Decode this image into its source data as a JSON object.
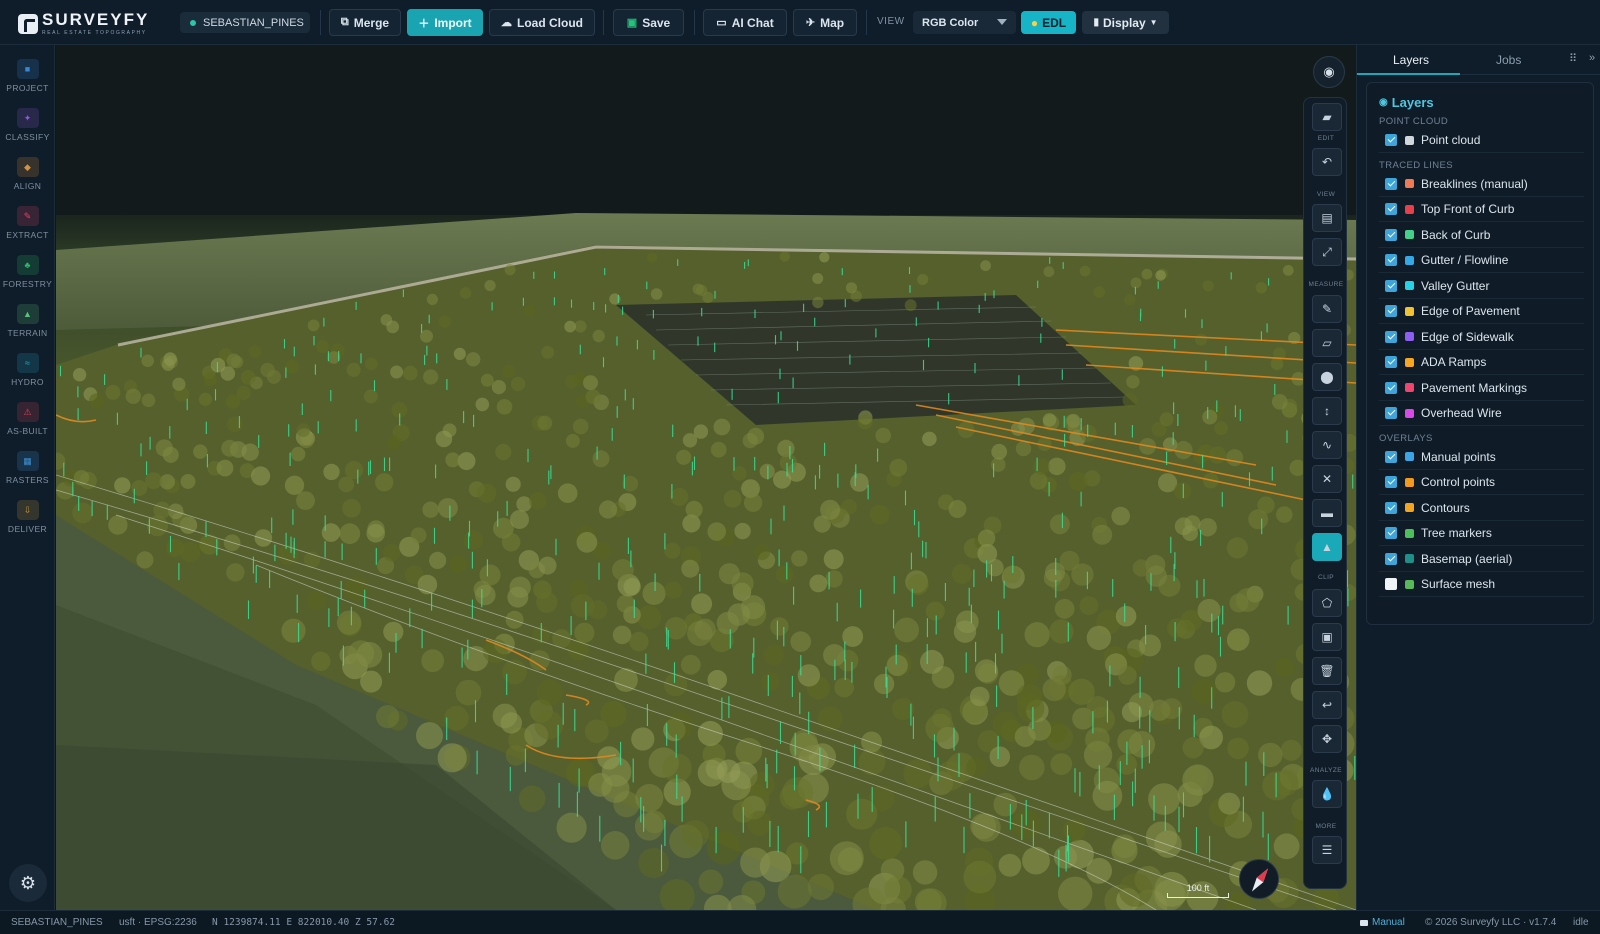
{
  "app": {
    "logo_name": "SURVEYFY",
    "logo_sub": "REAL ESTATE TOPOGRAPHY",
    "project_name": "SEBASTIAN_PINES"
  },
  "toolbar": {
    "merge": "Merge",
    "import": "Import",
    "load_cloud": "Load Cloud",
    "save": "Save",
    "ai_chat": "AI Chat",
    "map": "Map",
    "view_label": "VIEW",
    "view_value": "RGB Color",
    "edl": "EDL",
    "display": "Display"
  },
  "left_rail": [
    {
      "label": "PROJECT",
      "icon": "project-icon",
      "color": "#3a86d6"
    },
    {
      "label": "CLASSIFY",
      "icon": "classify-icon",
      "color": "#8a5bd6"
    },
    {
      "label": "ALIGN",
      "icon": "align-icon",
      "color": "#d6913a"
    },
    {
      "label": "EXTRACT",
      "icon": "extract-icon",
      "color": "#e0456b"
    },
    {
      "label": "FORESTRY",
      "icon": "forestry-icon",
      "color": "#2fb96a"
    },
    {
      "label": "TERRAIN",
      "icon": "terrain-icon",
      "color": "#59c37a"
    },
    {
      "label": "HYDRO",
      "icon": "hydro-icon",
      "color": "#2aa6c4"
    },
    {
      "label": "AS-BUILT",
      "icon": "as-built-icon",
      "color": "#d8455a"
    },
    {
      "label": "RASTERS",
      "icon": "rasters-icon",
      "color": "#3c8fd0"
    },
    {
      "label": "DELIVER",
      "icon": "deliver-icon",
      "color": "#c99a3a"
    }
  ],
  "tool_strip": {
    "sections": [
      "EDIT",
      "VIEW",
      "MEASURE",
      "CLIP",
      "ANALYZE",
      "MORE"
    ],
    "scale_label": "100 ft"
  },
  "right_panel": {
    "tabs": [
      "Layers",
      "Jobs"
    ],
    "title": "Layers",
    "sections": [
      {
        "name": "POINT CLOUD",
        "layers": [
          {
            "name": "Point cloud",
            "checked": true,
            "color": "#cfd6dc"
          }
        ]
      },
      {
        "name": "TRACED LINES",
        "layers": [
          {
            "name": "Breaklines (manual)",
            "checked": true,
            "color": "#f07a56"
          },
          {
            "name": "Top Front of Curb",
            "checked": true,
            "color": "#e8404a"
          },
          {
            "name": "Back of Curb",
            "checked": true,
            "color": "#44d08a"
          },
          {
            "name": "Gutter / Flowline",
            "checked": true,
            "color": "#35a8e6"
          },
          {
            "name": "Valley Gutter",
            "checked": true,
            "color": "#26d3e6"
          },
          {
            "name": "Edge of Pavement",
            "checked": true,
            "color": "#f1c232"
          },
          {
            "name": "Edge of Sidewalk",
            "checked": true,
            "color": "#8d5ff0"
          },
          {
            "name": "ADA Ramps",
            "checked": true,
            "color": "#f5a623"
          },
          {
            "name": "Pavement Markings",
            "checked": true,
            "color": "#f0456e"
          },
          {
            "name": "Overhead Wire",
            "checked": true,
            "color": "#d84ae8"
          }
        ]
      },
      {
        "name": "OVERLAYS",
        "layers": [
          {
            "name": "Manual points",
            "checked": true,
            "color": "#3da5e6"
          },
          {
            "name": "Control points",
            "checked": true,
            "color": "#f39a1e"
          },
          {
            "name": "Contours",
            "checked": true,
            "color": "#f3a522"
          },
          {
            "name": "Tree markers",
            "checked": true,
            "color": "#4cbf5a"
          },
          {
            "name": "Basemap (aerial)",
            "checked": true,
            "color": "#1f8f8a"
          },
          {
            "name": "Surface mesh",
            "checked": false,
            "color": "#58b85a"
          }
        ]
      }
    ]
  },
  "status": {
    "project": "SEBASTIAN_PINES",
    "crs": "usft · EPSG:2236",
    "coords": "N 1239874.11 E 822010.40 Z 57.62",
    "mode": "Manual",
    "copyright": "© 2026 Surveyfy LLC · v1.7.4",
    "state": "idle"
  }
}
